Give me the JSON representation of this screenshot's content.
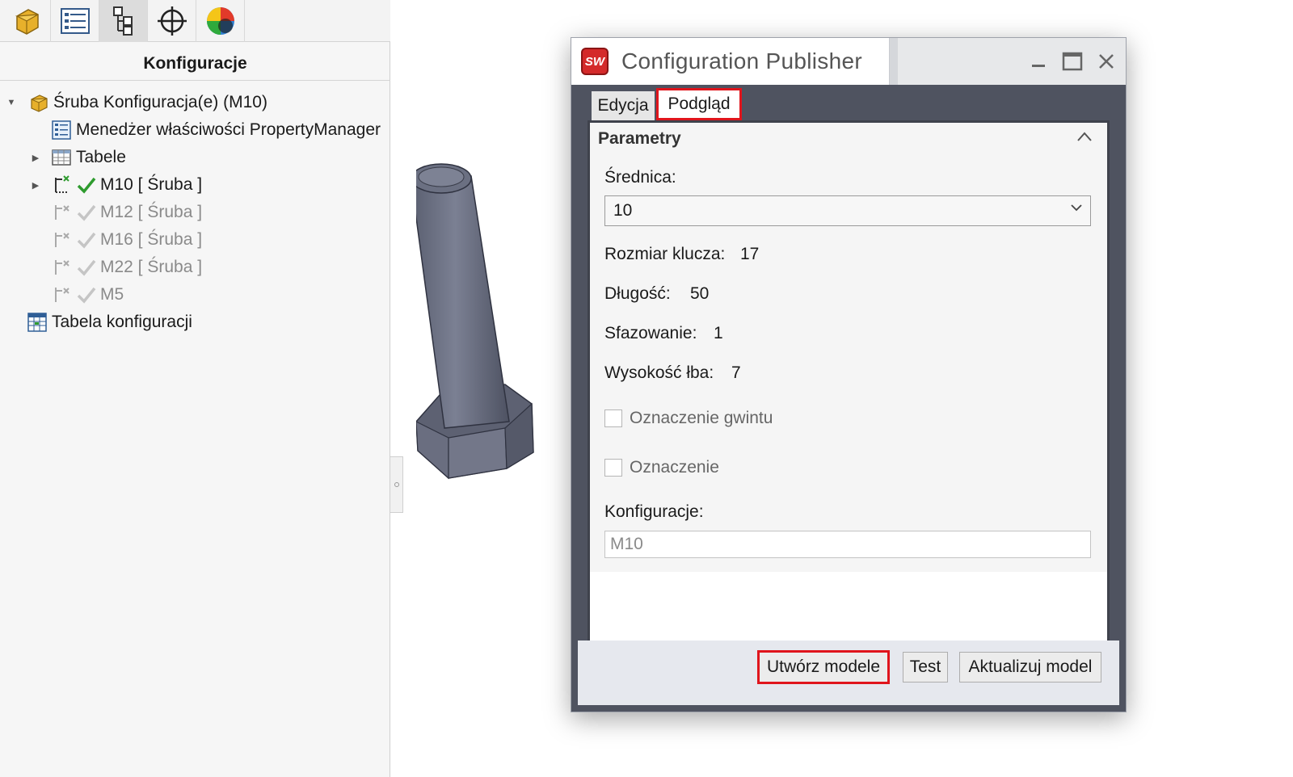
{
  "left_panel": {
    "title": "Konfiguracje",
    "toolbar": [
      {
        "icon": "part-feature-icon"
      },
      {
        "icon": "property-manager-icon"
      },
      {
        "icon": "configuration-manager-icon"
      },
      {
        "icon": "dimxpert-icon"
      },
      {
        "icon": "display-manager-icon"
      }
    ],
    "tree": {
      "root": "Śruba Konfiguracja(e)  (M10)",
      "property_manager": "Menedżer właściwości PropertyManager",
      "tables": "Tabele",
      "configs": [
        {
          "label": "M10 [ Śruba ]",
          "active": true
        },
        {
          "label": "M12 [ Śruba ]",
          "active": false
        },
        {
          "label": "M16 [ Śruba ]",
          "active": false
        },
        {
          "label": "M22 [ Śruba ]",
          "active": false
        },
        {
          "label": "M5",
          "active": false
        }
      ],
      "config_table": "Tabela konfiguracji"
    }
  },
  "dialog": {
    "title": "Configuration Publisher",
    "app_badge": "SW",
    "tabs": [
      {
        "label": "Edycja",
        "selected": false
      },
      {
        "label": "Podgląd",
        "selected": true
      }
    ],
    "group": "Parametry",
    "diameter": {
      "label": "Średnica:",
      "value": "10"
    },
    "fields": [
      {
        "label": "Rozmiar klucza:",
        "value": "17"
      },
      {
        "label": "Długość:",
        "value": "50"
      },
      {
        "label": "Sfazowanie:",
        "value": "1"
      },
      {
        "label": "Wysokość łba:",
        "value": "7"
      }
    ],
    "checkboxes": [
      {
        "label": "Oznaczenie gwintu",
        "checked": false
      },
      {
        "label": "Oznaczenie",
        "checked": false
      }
    ],
    "configurations": {
      "label": "Konfiguracje:",
      "value": "M10"
    },
    "buttons": {
      "create": "Utwórz modele",
      "test": "Test",
      "update": "Aktualizuj model"
    }
  },
  "colors": {
    "highlight": "#e0151c",
    "check_active": "#2e9b2e",
    "dialog_frame": "#4f5360"
  }
}
